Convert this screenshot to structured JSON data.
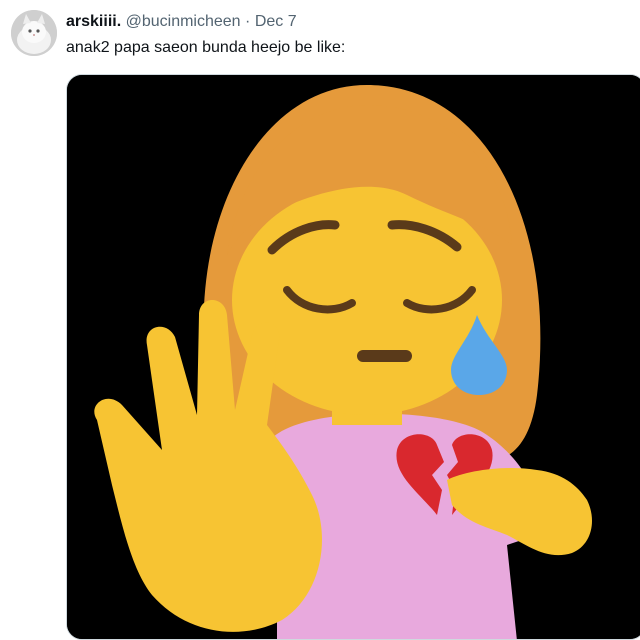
{
  "tweet": {
    "display_name": "arskiiii.",
    "handle": "@bucinmicheen",
    "separator": "·",
    "date": "Dec 7",
    "text": "anak2 papa saeon bunda heejo be like:"
  },
  "media": {
    "description_icon": "sad-girl-stop-hand-broken-heart-emoji"
  },
  "colors": {
    "name": "#0f1419",
    "meta": "#536471",
    "media_bg": "#000000",
    "hair": "#e59a3b",
    "skin": "#f7c433",
    "shirt": "#e8a9dd",
    "heart": "#d9282e",
    "tear": "#5aa7e8"
  }
}
